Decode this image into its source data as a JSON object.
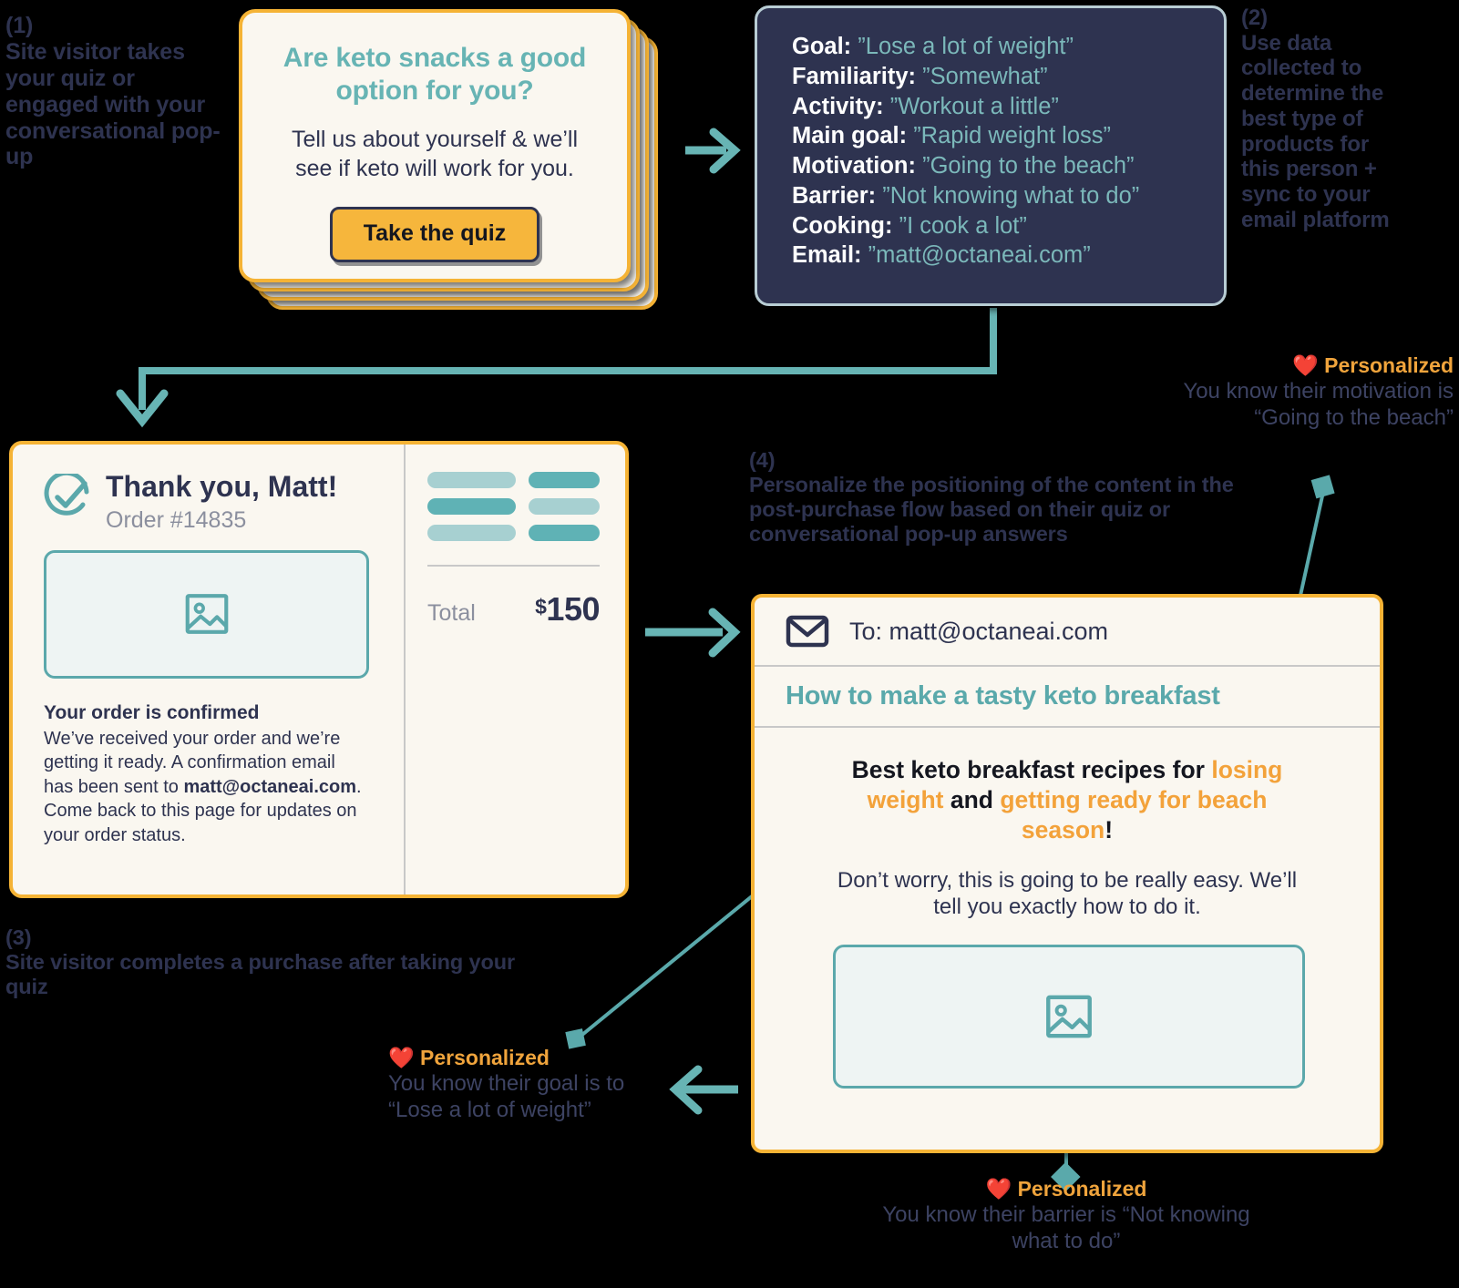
{
  "steps": {
    "one": {
      "num": "(1)",
      "text": "Site visitor takes your quiz or engaged with your conversational pop-up"
    },
    "two": {
      "num": "(2)",
      "text": "Use data collected to determine the best type of products for this person + sync to your email platform"
    },
    "three": {
      "num": "(3)",
      "text": "Site visitor completes a purchase after taking your quiz"
    },
    "four": {
      "num": "(4)",
      "text": "Personalize the positioning of the content in the post-purchase flow based on their quiz or conversational pop-up answers"
    }
  },
  "quiz_popup": {
    "title": "Are keto snacks a good option for you?",
    "subtitle": "Tell us about yourself & we’ll see if keto will work for you.",
    "button_label": "Take the quiz",
    "stack_count": 4
  },
  "answers_card": {
    "rows": [
      {
        "key": "Goal:",
        "value": "”Lose a lot of weight”"
      },
      {
        "key": "Familiarity:",
        "value": "”Somewhat”"
      },
      {
        "key": "Activity:",
        "value": "”Workout a little”"
      },
      {
        "key": "Main goal:",
        "value": "”Rapid weight loss”"
      },
      {
        "key": "Motivation:",
        "value": "”Going to the beach”"
      },
      {
        "key": "Barrier:",
        "value": "”Not knowing what to do”"
      },
      {
        "key": "Cooking:",
        "value": "”I cook a lot”"
      },
      {
        "key": "Email:",
        "value": "”matt@octaneai.com”"
      }
    ]
  },
  "order_card": {
    "title": "Thank you, Matt!",
    "order_number": "Order #14835",
    "confirm_heading": "Your order is confirmed",
    "confirm_body_1": "We’ve received your order and we’re getting it ready. A confirmation email has been sent to ",
    "confirm_body_email": "matt@octaneai.com",
    "confirm_body_2": ". Come back to this page for updates on your order status.",
    "total_label": "Total",
    "total_currency": "$",
    "total_value": "150",
    "skeleton_colors": [
      "#a7d0d1",
      "#5fb2b5",
      "#5fb2b5",
      "#a7d0d1",
      "#a7d0d1",
      "#5fb2b5"
    ]
  },
  "email_card": {
    "to_line": "To: matt@octaneai.com",
    "subject": "How to make a tasty keto breakfast",
    "headline_part_1": "Best keto breakfast recipes for ",
    "headline_hl_1": "losing weight",
    "headline_part_2": " and ",
    "headline_hl_2": "getting ready for beach season",
    "headline_part_3": "!",
    "body": "Don’t worry, this is going to be really easy. We’ll tell you exactly how to do it."
  },
  "personalized": {
    "motivation": {
      "label": "❤️ Personalized",
      "heart": "❤️",
      "title": "Personalized",
      "body": "You know their motivation is “Going to the beach”"
    },
    "goal": {
      "heart": "❤️",
      "title": "Personalized",
      "body": "You know their goal is to “Lose a lot of weight”"
    },
    "barrier": {
      "heart": "❤️",
      "title": "Personalized",
      "body": "You know their barrier is “Not knowing what to do”"
    }
  },
  "colors": {
    "background": "#000000",
    "accent_orange": "#f5b335",
    "accent_teal": "#67b4b4",
    "dark_navy": "#2e3350",
    "card_cream": "#faf7f0",
    "heart_red": "#e8392e"
  }
}
